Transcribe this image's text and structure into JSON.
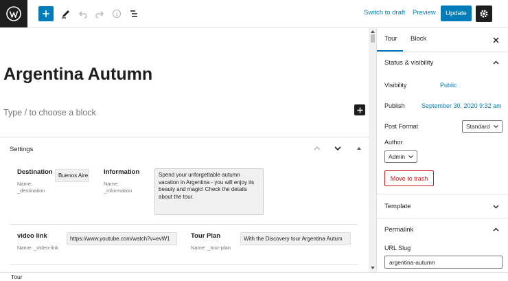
{
  "toolbar": {
    "switch_to_draft": "Switch to draft",
    "preview": "Preview",
    "update": "Update",
    "accent_color": "#007cba"
  },
  "post": {
    "title": "Argentina Autumn",
    "block_placeholder": "Type / to choose a block"
  },
  "settings_panel": {
    "title": "Settings",
    "fields": {
      "destination": {
        "label": "Destination",
        "name": "Name: _destination",
        "value": "Buenos Aire"
      },
      "information": {
        "label": "Information",
        "name": "Name: _information",
        "value": "Spend your unforgettable autumn vacation in Argentina - you will enjoy its beauty and magic! Check the details about the tour."
      },
      "video_link": {
        "label": "video link",
        "name": "Name: _video-link",
        "value": "https://www.youtube.com/watch?v=evW1"
      },
      "tour_plan": {
        "label": "Tour Plan",
        "name": "Name: _tour-plan",
        "value": "With the Discovery tour Argentina Autum"
      }
    }
  },
  "sidebar": {
    "tabs": {
      "tour": "Tour",
      "block": "Block"
    },
    "status": {
      "heading": "Status & visibility",
      "visibility_label": "Visibility",
      "visibility_value": "Public",
      "publish_label": "Publish",
      "publish_value": "September 30, 2020 9:32 am",
      "post_format_label": "Post Format",
      "post_format_value": "Standard",
      "author_label": "Author",
      "author_value": "Admin",
      "trash": "Move to trash"
    },
    "template": {
      "heading": "Template"
    },
    "permalink": {
      "heading": "Permalink",
      "slug_label": "URL Slug",
      "slug_value": "argentina-autumn"
    }
  },
  "footer": {
    "breadcrumb": "Tour"
  },
  "icons": [
    "wordpress-logo-icon",
    "plus-icon",
    "pencil-icon",
    "undo-icon",
    "redo-icon",
    "info-icon",
    "list-view-icon",
    "gear-icon",
    "close-icon",
    "chevron-up-icon",
    "chevron-down-icon"
  ]
}
